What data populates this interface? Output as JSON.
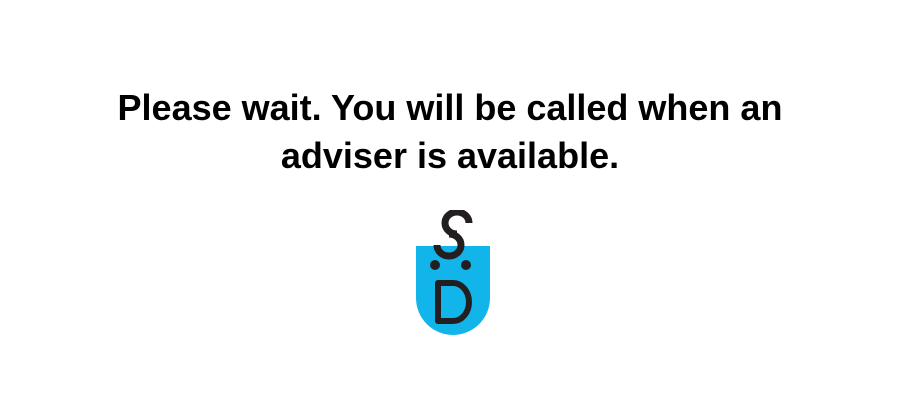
{
  "waiting_screen": {
    "message_line_1": "Please wait. You will be called when an",
    "message_line_2": "adviser is available."
  },
  "logo": {
    "icon": "smiling-s-d-face-logo",
    "colors": {
      "face": "#12b5ea",
      "features": "#231f20"
    }
  }
}
